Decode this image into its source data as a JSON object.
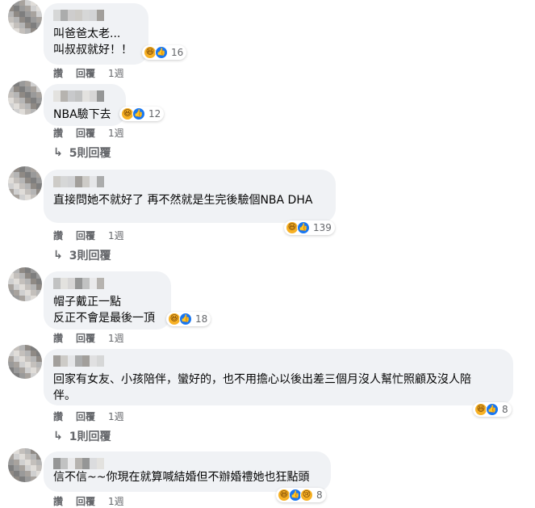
{
  "comments": [
    {
      "lines": [
        "叫爸爸太老...",
        "叫叔叔就好！！"
      ],
      "reactions": [
        "haha",
        "like"
      ],
      "reaction_count": "16",
      "actions": {
        "like": "讚",
        "reply": "回覆",
        "time": "1週"
      },
      "replies_link": ""
    },
    {
      "lines": [
        "NBA驗下去"
      ],
      "reactions": [
        "haha",
        "like"
      ],
      "reaction_count": "12",
      "actions": {
        "like": "讚",
        "reply": "回覆",
        "time": "1週"
      },
      "replies_link": "5則回覆"
    },
    {
      "lines": [
        "直接問她不就好了 再不然就是生完後驗個NBA DHA"
      ],
      "reactions": [
        "haha",
        "like"
      ],
      "reaction_count": "139",
      "actions": {
        "like": "讚",
        "reply": "回覆",
        "time": "1週"
      },
      "replies_link": "3則回覆"
    },
    {
      "lines": [
        "帽子戴正一點",
        "反正不會是最後一頂"
      ],
      "reactions": [
        "haha",
        "like"
      ],
      "reaction_count": "18",
      "actions": {
        "like": "讚",
        "reply": "回覆",
        "time": "1週"
      },
      "replies_link": ""
    },
    {
      "lines": [
        "回家有女友、小孩陪伴，蠻好的，也不用擔心以後出差三個月沒人幫忙照顧及沒人陪",
        "伴。"
      ],
      "reactions": [
        "haha",
        "like"
      ],
      "reaction_count": "8",
      "actions": {
        "like": "讚",
        "reply": "回覆",
        "time": "1週"
      },
      "replies_link": "1則回覆"
    },
    {
      "lines": [
        "信不信~~你現在就算喊結婚但不辦婚禮她也狂點頭"
      ],
      "reactions": [
        "haha",
        "like",
        "sad"
      ],
      "reaction_count": "8",
      "actions": {
        "like": "讚",
        "reply": "回覆",
        "time": "1週"
      },
      "replies_link": ""
    }
  ],
  "colors": {
    "bubble": "#f0f2f5",
    "meta_text": "#65676b",
    "like_blue": "#1877f2",
    "haha_yellow": "#f7b125"
  },
  "icons": {
    "haha": "haha-reaction-icon",
    "like": "like-reaction-icon",
    "sad": "sad-reaction-icon",
    "reply_arrow": "reply-arrow-icon"
  }
}
